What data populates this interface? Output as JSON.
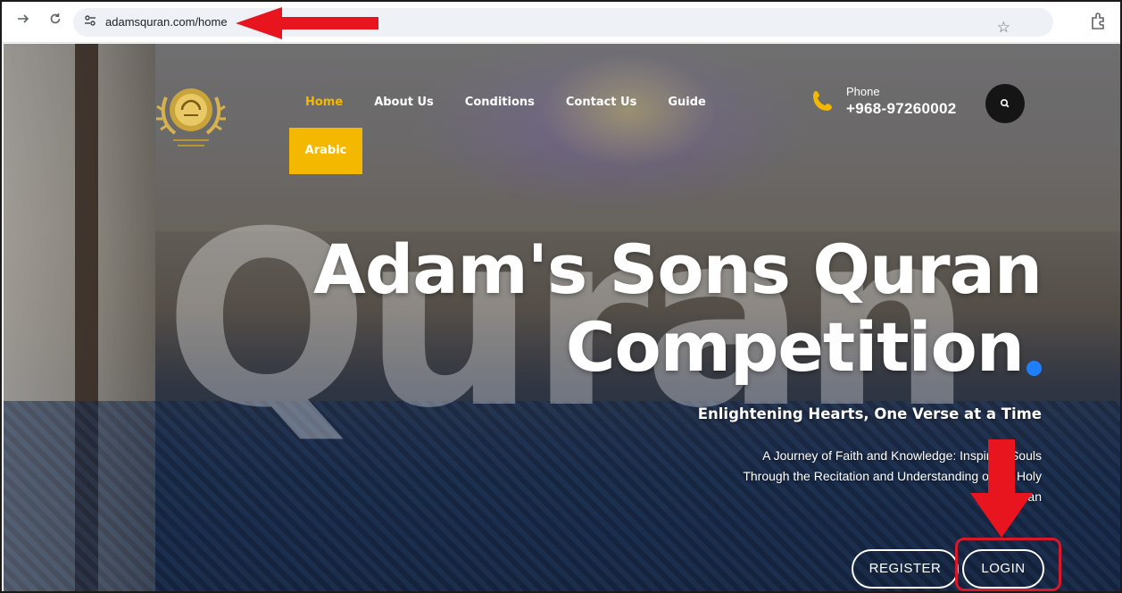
{
  "browser": {
    "url": "adamsquran.com/home",
    "forward_icon": "arrow-right-icon",
    "reload_icon": "reload-icon",
    "site_info_icon": "tune-icon",
    "bookmark_icon": "star-icon",
    "extensions_icon": "puzzle-icon"
  },
  "header": {
    "nav": [
      "Home",
      "About Us",
      "Conditions",
      "Contact Us",
      "Guide"
    ],
    "active_nav": "Home",
    "arabic_label": "Arabic",
    "phone_label": "Phone",
    "phone_number": "+968-97260002",
    "search_icon": "search-icon"
  },
  "hero": {
    "background_word": "Quran",
    "title_line1": "Adam's Sons Quran",
    "title_line2": "Competition",
    "tagline": "Enlightening Hearts, One Verse at a Time",
    "description": "A Journey of Faith and Knowledge: Inspiring Souls Through the Recitation and Understanding of the Holy Quran",
    "register_label": "REGISTER",
    "login_label": "LOGIN"
  },
  "colors": {
    "accent": "#f5b800",
    "dot": "#1e80ff",
    "annotation": "#d6182a"
  }
}
